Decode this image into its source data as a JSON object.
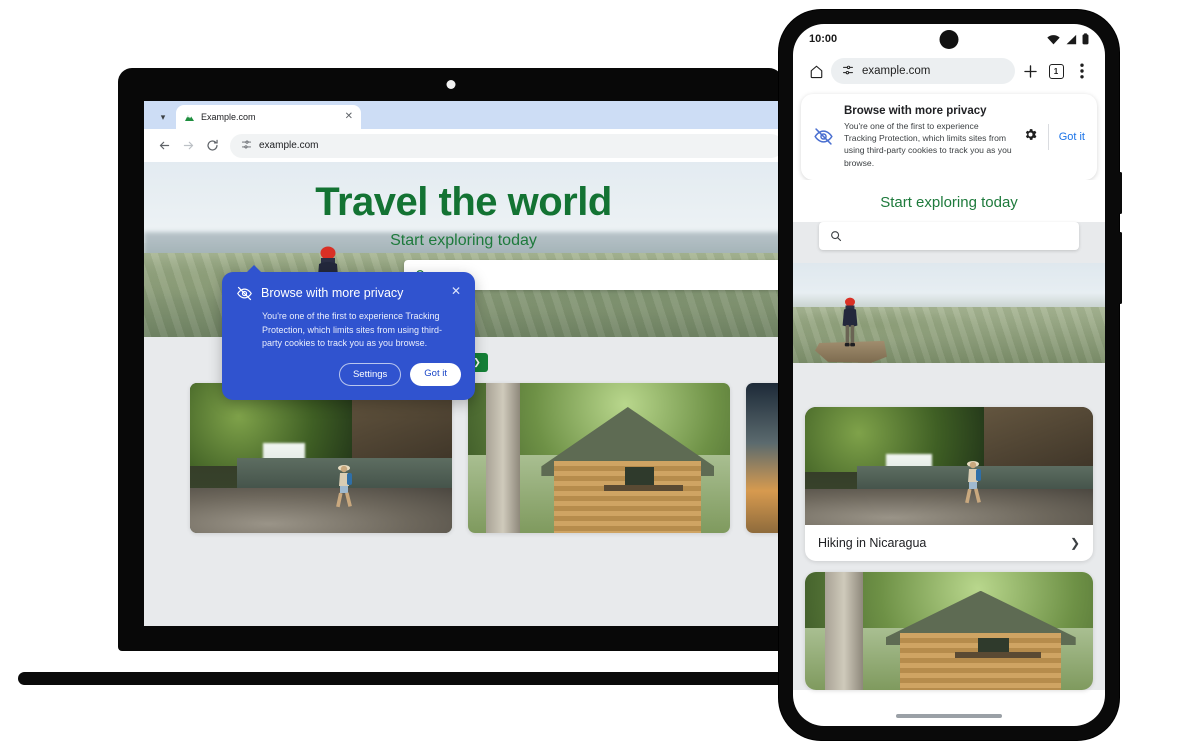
{
  "desktop": {
    "tabstrip": {
      "tab_search_icon": "chevron-down-icon",
      "tab": {
        "favicon": "example-mountain-favicon",
        "title": "Example.com",
        "close_icon": "close-icon"
      }
    },
    "toolbar": {
      "back_icon": "arrow-back-icon",
      "forward_icon": "arrow-forward-icon",
      "reload_icon": "reload-icon",
      "site_settings_icon": "tune-icon",
      "url": "example.com"
    },
    "hero": {
      "headline": "Travel the world",
      "subheadline": "Start exploring today",
      "search_icon": "search-icon",
      "search_value": "",
      "image_alt": "hiker-on-cliff"
    },
    "carousel": {
      "prev_icon": "chevron-left-icon",
      "next_icon": "chevron-right-icon",
      "prev_enabled": "false",
      "next_enabled": "true"
    },
    "cards": [
      {
        "image_alt": "waterfall-hiker"
      },
      {
        "image_alt": "log-cabin"
      },
      {
        "image_alt": "sunset-coast"
      }
    ],
    "promo": {
      "icon": "eye-slash-icon",
      "title": "Browse with more privacy",
      "close_icon": "close-icon",
      "body": "You're one of the first to experience Tracking Protection, which limits sites from using third-party cookies to track you as you browse.",
      "settings_label": "Settings",
      "gotit_label": "Got it",
      "background_color": "#3053cf"
    }
  },
  "phone": {
    "status": {
      "time": "10:00",
      "wifi_icon": "wifi-icon",
      "signal_icon": "signal-icon",
      "battery_icon": "battery-icon"
    },
    "toolbar": {
      "home_icon": "home-icon",
      "site_settings_icon": "tune-icon",
      "url": "example.com",
      "new_tab_icon": "plus-icon",
      "tab_count": "1",
      "menu_icon": "more-vertical-icon"
    },
    "promo": {
      "icon": "eye-slash-icon",
      "title": "Browse with more privacy",
      "body": "You're one of the first to experience Tracking Protection, which limits sites from using third-party cookies to track you as you browse.",
      "settings_icon": "gear-icon",
      "gotit_label": "Got it",
      "gotit_color": "#1a73e8"
    },
    "page": {
      "subheadline": "Start exploring today",
      "search_icon": "search-icon",
      "search_value": "",
      "hero_image_alt": "hiker-on-cliff"
    },
    "cards": [
      {
        "image_alt": "waterfall-hiker",
        "label": "Hiking in Nicaragua",
        "chevron_icon": "chevron-right-icon"
      },
      {
        "image_alt": "log-cabin",
        "label": "",
        "chevron_icon": ""
      }
    ],
    "gesture_bar": "home-indicator"
  },
  "theme": {
    "brand_green": "#137333",
    "promo_blue": "#3053cf",
    "link_blue": "#1a73e8"
  }
}
